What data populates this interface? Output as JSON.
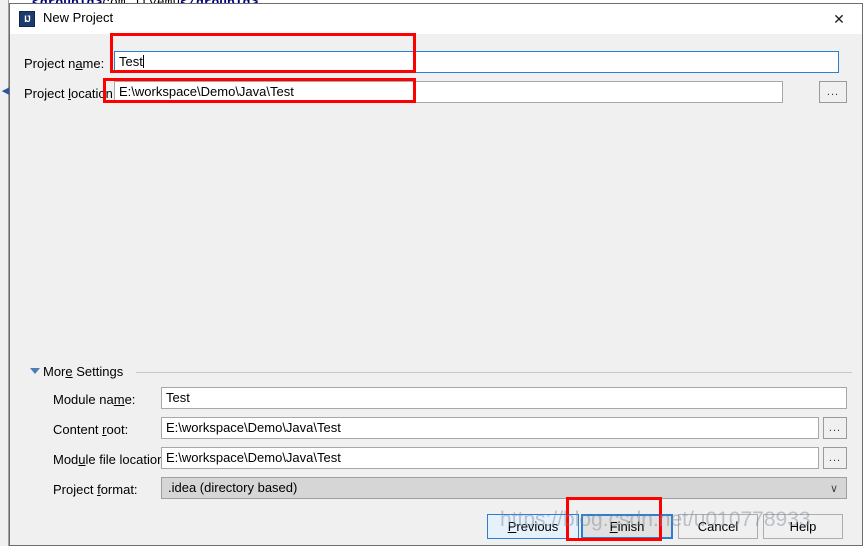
{
  "background": {
    "code_line_open_tag": "<groupId>",
    "code_line_text": "com.ityemu",
    "code_line_close_tag": "</groupId>",
    "collapse_arrow": "◀"
  },
  "dialog": {
    "title": "New Project",
    "icon_label": "IJ",
    "close_icon": "✕"
  },
  "form": {
    "project_name_label_pre": "Project n",
    "project_name_label_mn": "a",
    "project_name_label_post": "me:",
    "project_name_value": "Test",
    "project_location_label_pre": "Project ",
    "project_location_label_mn": "l",
    "project_location_label_post": "ocation:",
    "project_location_value": "E:\\workspace\\Demo\\Java\\Test",
    "browse_label": "..."
  },
  "more_settings": {
    "section_label_pre": "Mor",
    "section_label_mn": "e",
    "section_label_post": " Settings",
    "module_name_label_pre": "Module na",
    "module_name_label_mn": "m",
    "module_name_label_post": "e:",
    "module_name_value": "Test",
    "content_root_label_pre": "Content ",
    "content_root_label_mn": "r",
    "content_root_label_post": "oot:",
    "content_root_value": "E:\\workspace\\Demo\\Java\\Test",
    "module_file_label_pre": "Mod",
    "module_file_label_mn": "u",
    "module_file_label_post": "le file location:",
    "module_file_value": "E:\\workspace\\Demo\\Java\\Test",
    "project_format_label_pre": "Project ",
    "project_format_label_mn": "f",
    "project_format_label_post": "ormat:",
    "project_format_value": ".idea (directory based)",
    "project_format_arrow": "∨",
    "browse_label": "..."
  },
  "footer": {
    "previous_pre": "",
    "previous_mn": "P",
    "previous_post": "revious",
    "finish_pre": "",
    "finish_mn": "F",
    "finish_post": "inish",
    "cancel_label": "Cancel",
    "help_label": "Help"
  },
  "watermark": {
    "text": "https://blog.csdn.net/u010778933"
  },
  "colors": {
    "annotation": "#ff0000",
    "focus_blue": "#2a7fd4",
    "dialog_bg": "#f0f0f0",
    "xml_tag": "#000080"
  }
}
